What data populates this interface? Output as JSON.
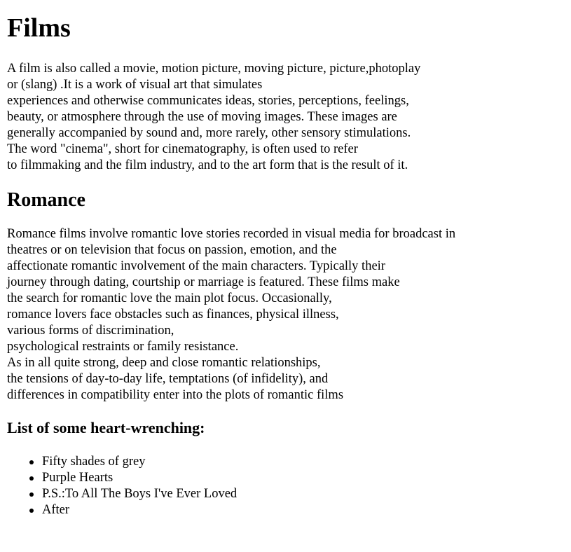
{
  "title": "Films",
  "intro_lines": [
    "A film is also called a movie, motion picture, moving picture, picture,photoplay",
    "or (slang) .It is a work of visual art that simulates",
    "experiences and otherwise communicates ideas, stories, perceptions, feelings,",
    "beauty, or atmosphere through the use of moving images. These images are",
    "generally accompanied by sound and, more rarely, other sensory stimulations.",
    "The word \"cinema\", short for cinematography, is often used to refer",
    "to filmmaking and the film industry, and to the art form that is the result of it."
  ],
  "romance": {
    "heading": "Romance",
    "lines": [
      "Romance films involve romantic love stories recorded in visual media for broadcast in",
      "theatres or on television that focus on passion, emotion, and the",
      "affectionate romantic involvement of the main characters. Typically their",
      "journey through dating, courtship or marriage is featured. These films make",
      "the search for romantic love the main plot focus. Occasionally,",
      "romance lovers face obstacles such as finances, physical illness,",
      "various forms of discrimination,",
      "psychological restraints or family resistance.",
      "As in all quite strong, deep and close romantic relationships,",
      "the tensions of day-to-day life, temptations (of infidelity), and",
      "differences in compatibility enter into the plots of romantic films"
    ]
  },
  "list": {
    "heading": "List of some heart-wrenching:",
    "items": [
      "Fifty shades of grey",
      "Purple Hearts",
      "P.S.:To All The Boys I've Ever Loved",
      "After"
    ]
  }
}
